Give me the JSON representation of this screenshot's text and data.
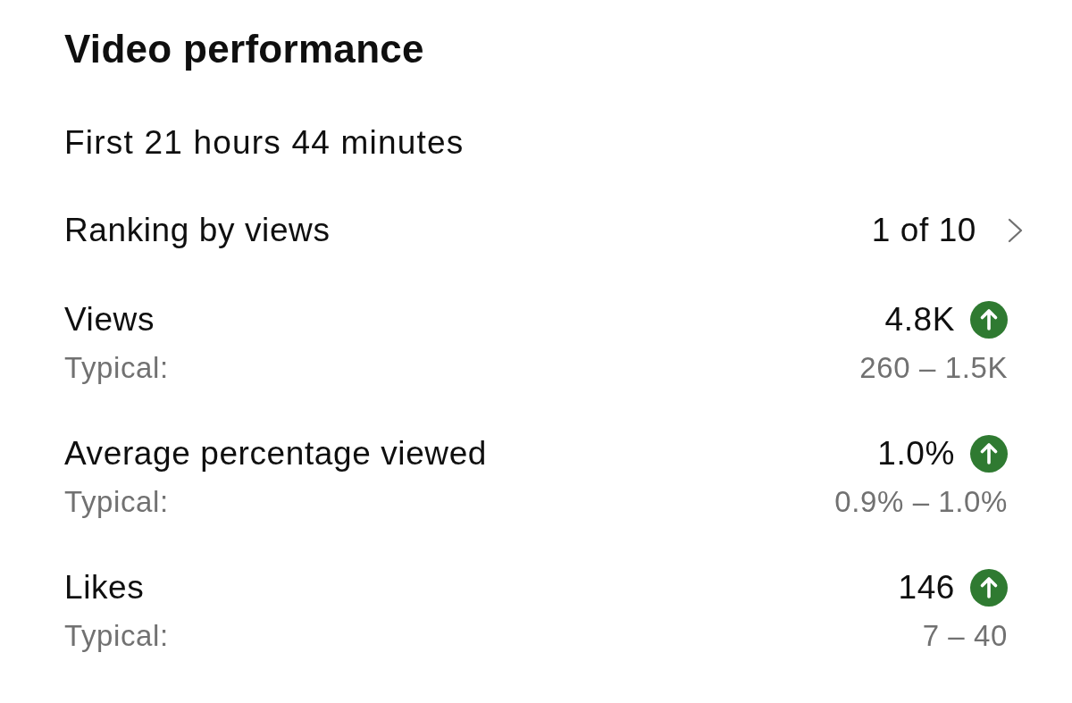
{
  "title": "Video performance",
  "period": "First 21 hours 44 minutes",
  "ranking": {
    "label": "Ranking by views",
    "value": "1 of 10"
  },
  "metrics": [
    {
      "label": "Views",
      "value": "4.8K",
      "above_typical": true,
      "typical_label": "Typical:",
      "typical_range": "260 – 1.5K"
    },
    {
      "label": "Average percentage viewed",
      "value": "1.0%",
      "above_typical": true,
      "typical_label": "Typical:",
      "typical_range": "0.9% – 1.0%"
    },
    {
      "label": "Likes",
      "value": "146",
      "above_typical": true,
      "typical_label": "Typical:",
      "typical_range": "7 – 40"
    }
  ]
}
